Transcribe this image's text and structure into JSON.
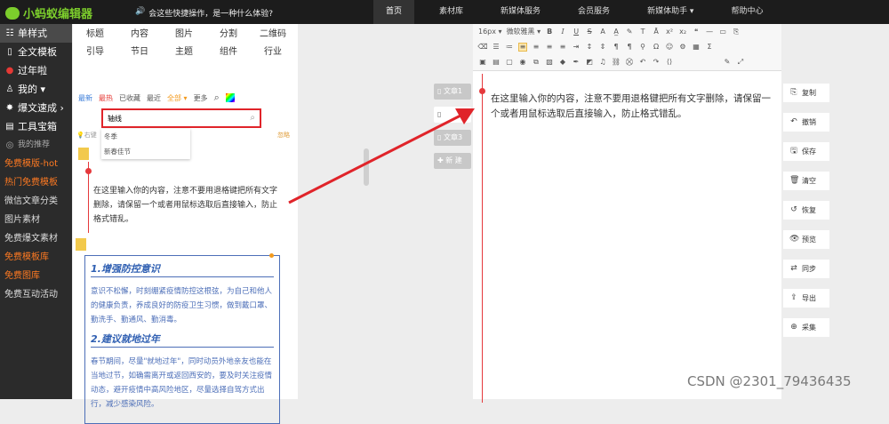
{
  "header": {
    "logo_text": "小蚂蚁编辑器",
    "notice": "会这些快捷操作，是一种什么体验?",
    "nav": [
      "首页",
      "素材库",
      "新媒体服务",
      "会员服务",
      "新媒体助手 ▾",
      "帮助中心"
    ]
  },
  "sidebar": {
    "items": [
      {
        "icon": "☷",
        "label": "单样式"
      },
      {
        "icon": "▯",
        "label": "全文模板"
      },
      {
        "icon": "●",
        "label": "过年啦"
      },
      {
        "icon": "♙",
        "label": "我的 ▾"
      },
      {
        "icon": "✸",
        "label": "爆文速成 ›"
      },
      {
        "icon": "▤",
        "label": "工具宝箱"
      },
      {
        "icon": "◎",
        "label": "我的推荐"
      },
      {
        "icon": "",
        "label": "免费模版-hot"
      },
      {
        "icon": "",
        "label": "热门免费模板"
      },
      {
        "icon": "",
        "label": "微信文章分类"
      },
      {
        "icon": "",
        "label": "图片素材"
      },
      {
        "icon": "",
        "label": "免费爆文素材"
      },
      {
        "icon": "",
        "label": "免费模板库"
      },
      {
        "icon": "",
        "label": "免费图库"
      },
      {
        "icon": "",
        "label": "免费互动活动"
      }
    ]
  },
  "panel": {
    "categories": [
      "标题",
      "内容",
      "图片",
      "分割",
      "二维码",
      "引导",
      "节日",
      "主题",
      "组件",
      "行业"
    ],
    "filters": {
      "latest": "最新",
      "hot": "最热",
      "favorited": "已收藏",
      "recent": "最近",
      "all": "全部 ▾",
      "more": "更多"
    },
    "search": {
      "value": "轴线"
    },
    "suggestions": [
      "冬季",
      "新春佳节"
    ],
    "hint_left": "右键",
    "hint_right": "忽略",
    "template1_text": "在这里输入你的内容，注意不要用退格键把所有文字删除，请保留一个或者用鼠标选取后直接输入，防止格式错乱。",
    "template2": {
      "heading1": "1.增强防控意识",
      "para1": "意识不松懈，时刻绷紧疫情防控这根弦，为自己和他人的健康负责，养成良好的防疫卫生习惯，做到戴口罩、勤洗手、勤通风、勤消毒。",
      "heading2": "2.建议就地过年",
      "para2": "春节期间，尽量\"就地过年\"，同时动员外地亲友也能在当地过节，如确需离开或返回西安的，要及时关注疫情动态，避开疫情中高风险地区，尽量选择自驾方式出行，减少感染风险。"
    }
  },
  "doc_tabs": [
    "文章1",
    "",
    "文章3",
    "新 建"
  ],
  "editor": {
    "font_size": "16px ▾",
    "font_family": "微软雅黑 ▾",
    "content": "在这里输入你的内容，注意不要用退格键把所有文字删除，请保留一个或者用鼠标选取后直接输入，防止格式错乱。"
  },
  "actions": [
    {
      "icon": "⎘",
      "label": "复制"
    },
    {
      "icon": "↶",
      "label": "撤销"
    },
    {
      "icon": "🖫",
      "label": "保存"
    },
    {
      "icon": "🗑",
      "label": "清空"
    },
    {
      "icon": "↺",
      "label": "恢复"
    },
    {
      "icon": "👁",
      "label": "预览"
    },
    {
      "icon": "⇄",
      "label": "同步"
    },
    {
      "icon": "⇪",
      "label": "导出"
    },
    {
      "icon": "⊕",
      "label": "采集"
    }
  ],
  "watermark": "CSDN @2301_79436435",
  "colors": {
    "accent": "#7ccd2c",
    "highlight": "#e0242a",
    "orange": "#ff7a22",
    "template_blue": "#4d6fb8"
  }
}
